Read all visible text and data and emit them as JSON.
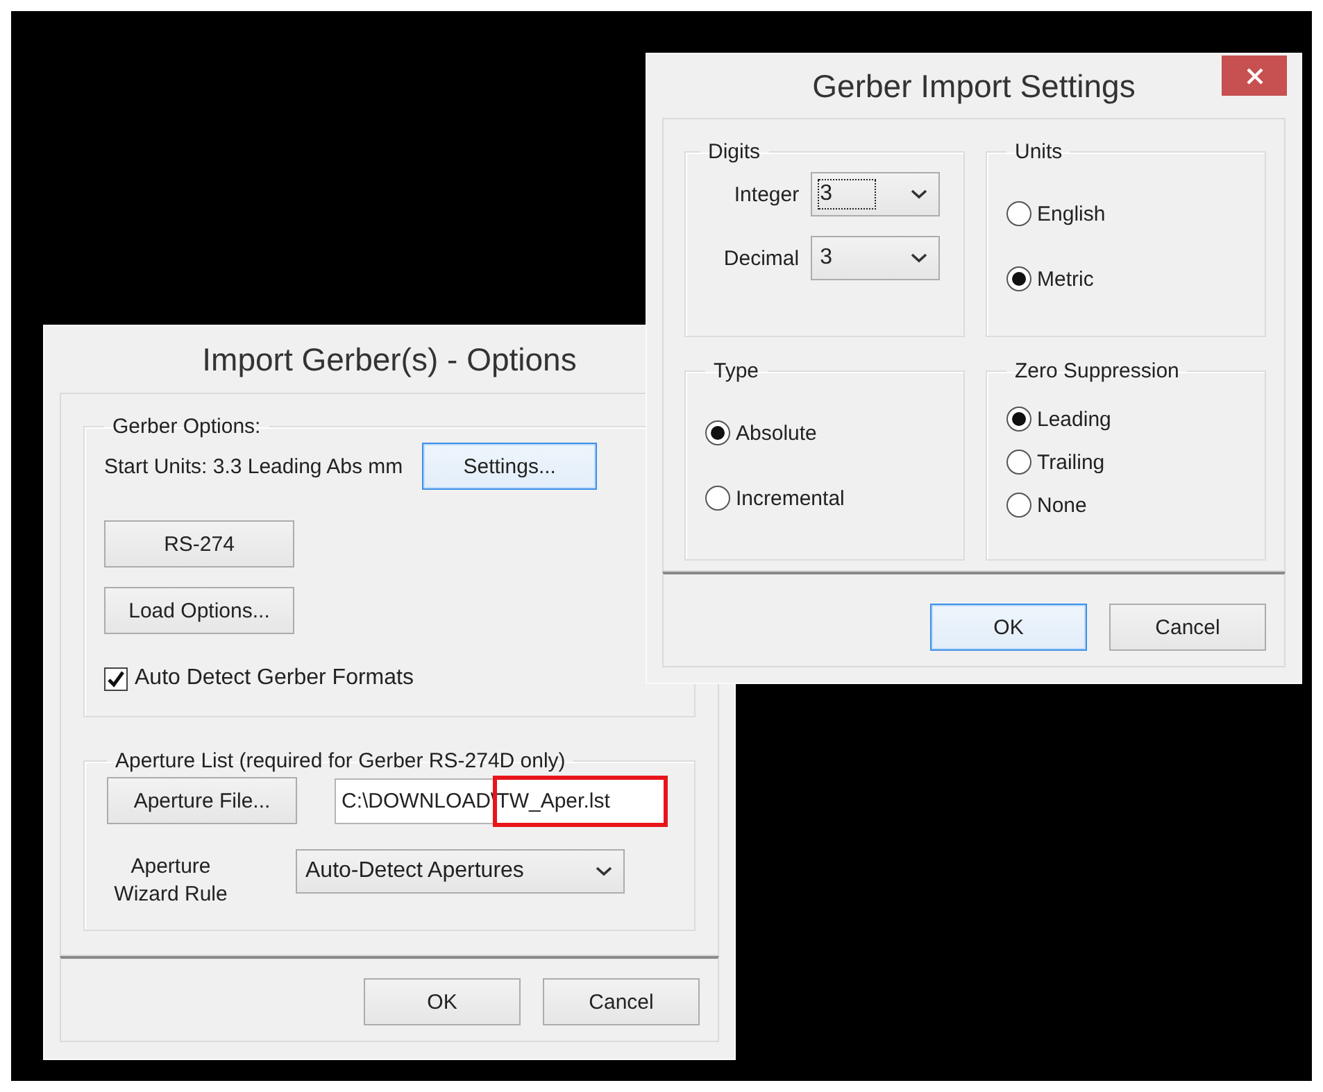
{
  "import_dialog": {
    "title": "Import Gerber(s) - Options",
    "gerber_options": {
      "label": "Gerber Options:",
      "start_units": "Start Units: 3.3 Leading Abs mm",
      "settings_button": {
        "label": "Settings...",
        "focused": true
      },
      "format_button": {
        "label": "RS-274",
        "focused": false
      },
      "load_options_button": {
        "label": "Load Options...",
        "focused": false
      },
      "auto_detect": {
        "label": "Auto Detect Gerber Formats",
        "checked": true
      }
    },
    "aperture_list": {
      "label": "Aperture List (required for Gerber RS-274D only)",
      "aperture_file_button": {
        "label": "Aperture File...",
        "focused": false
      },
      "file_path": {
        "value": "C:\\DOWNLOAD\\TW_Aper.lst",
        "highlighted": true
      },
      "wizard_rule_label": "Aperture Wizard Rule",
      "wizard_rule": {
        "value": "Auto-Detect Apertures",
        "focused": false
      }
    },
    "buttons": [
      {
        "label": "OK",
        "focused": false
      },
      {
        "label": "Cancel",
        "focused": false
      }
    ]
  },
  "settings_dialog": {
    "title": "Gerber Import Settings",
    "digits": {
      "label": "Digits",
      "fields": [
        {
          "label": "Integer",
          "value": "3",
          "focused": true
        },
        {
          "label": "Decimal",
          "value": "3",
          "focused": false
        }
      ]
    },
    "units": {
      "label": "Units",
      "options": [
        {
          "label": "English",
          "selected": false
        },
        {
          "label": "Metric",
          "selected": true
        }
      ]
    },
    "type": {
      "label": "Type",
      "options": [
        {
          "label": "Absolute",
          "selected": true
        },
        {
          "label": "Incremental",
          "selected": false
        }
      ]
    },
    "zero_suppression": {
      "label": "Zero Suppression",
      "options": [
        {
          "label": "Leading",
          "selected": true
        },
        {
          "label": "Trailing",
          "selected": false
        },
        {
          "label": "None",
          "selected": false
        }
      ]
    },
    "buttons": [
      {
        "label": "OK",
        "focused": true
      },
      {
        "label": "Cancel",
        "focused": false
      }
    ]
  }
}
